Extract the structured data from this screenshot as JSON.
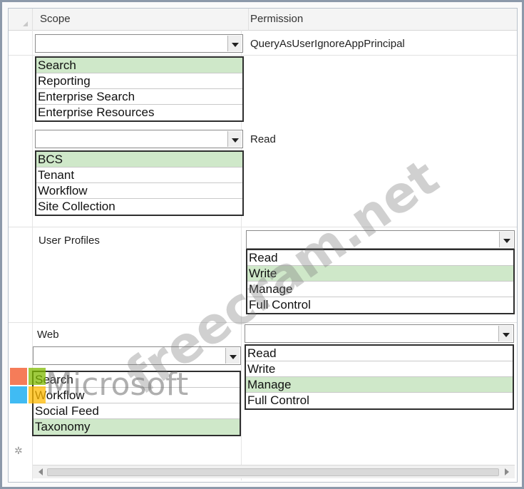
{
  "headers": {
    "scope": "Scope",
    "permission": "Permission"
  },
  "rows": [
    {
      "scope_list": [
        "Search",
        "Reporting",
        "Enterprise Search",
        "Enterprise Resources"
      ],
      "scope_selected": 0,
      "permission_text": "QueryAsUserIgnoreAppPrincipal"
    },
    {
      "scope_list": [
        "BCS",
        "Tenant",
        "Workflow",
        "Site Collection"
      ],
      "scope_selected": 0,
      "permission_text": "Read"
    },
    {
      "scope_text": "User Profiles",
      "permission_list": [
        "Read",
        "Write",
        "Manage",
        "Full Control"
      ],
      "permission_selected": 1
    },
    {
      "scope_text": "Web",
      "scope_list": [
        "Search",
        "Workflow",
        "Social Feed",
        "Taxonomy"
      ],
      "scope_selected": 3,
      "permission_list": [
        "Read",
        "Write",
        "Manage",
        "Full Control"
      ],
      "permission_selected": 2
    }
  ],
  "watermark": "freecram.net",
  "logo_text": "Microsoft",
  "logo_colors": [
    "#f25022",
    "#7fba00",
    "#00a4ef",
    "#ffb900"
  ],
  "highlight_color": "#cfe8c9"
}
